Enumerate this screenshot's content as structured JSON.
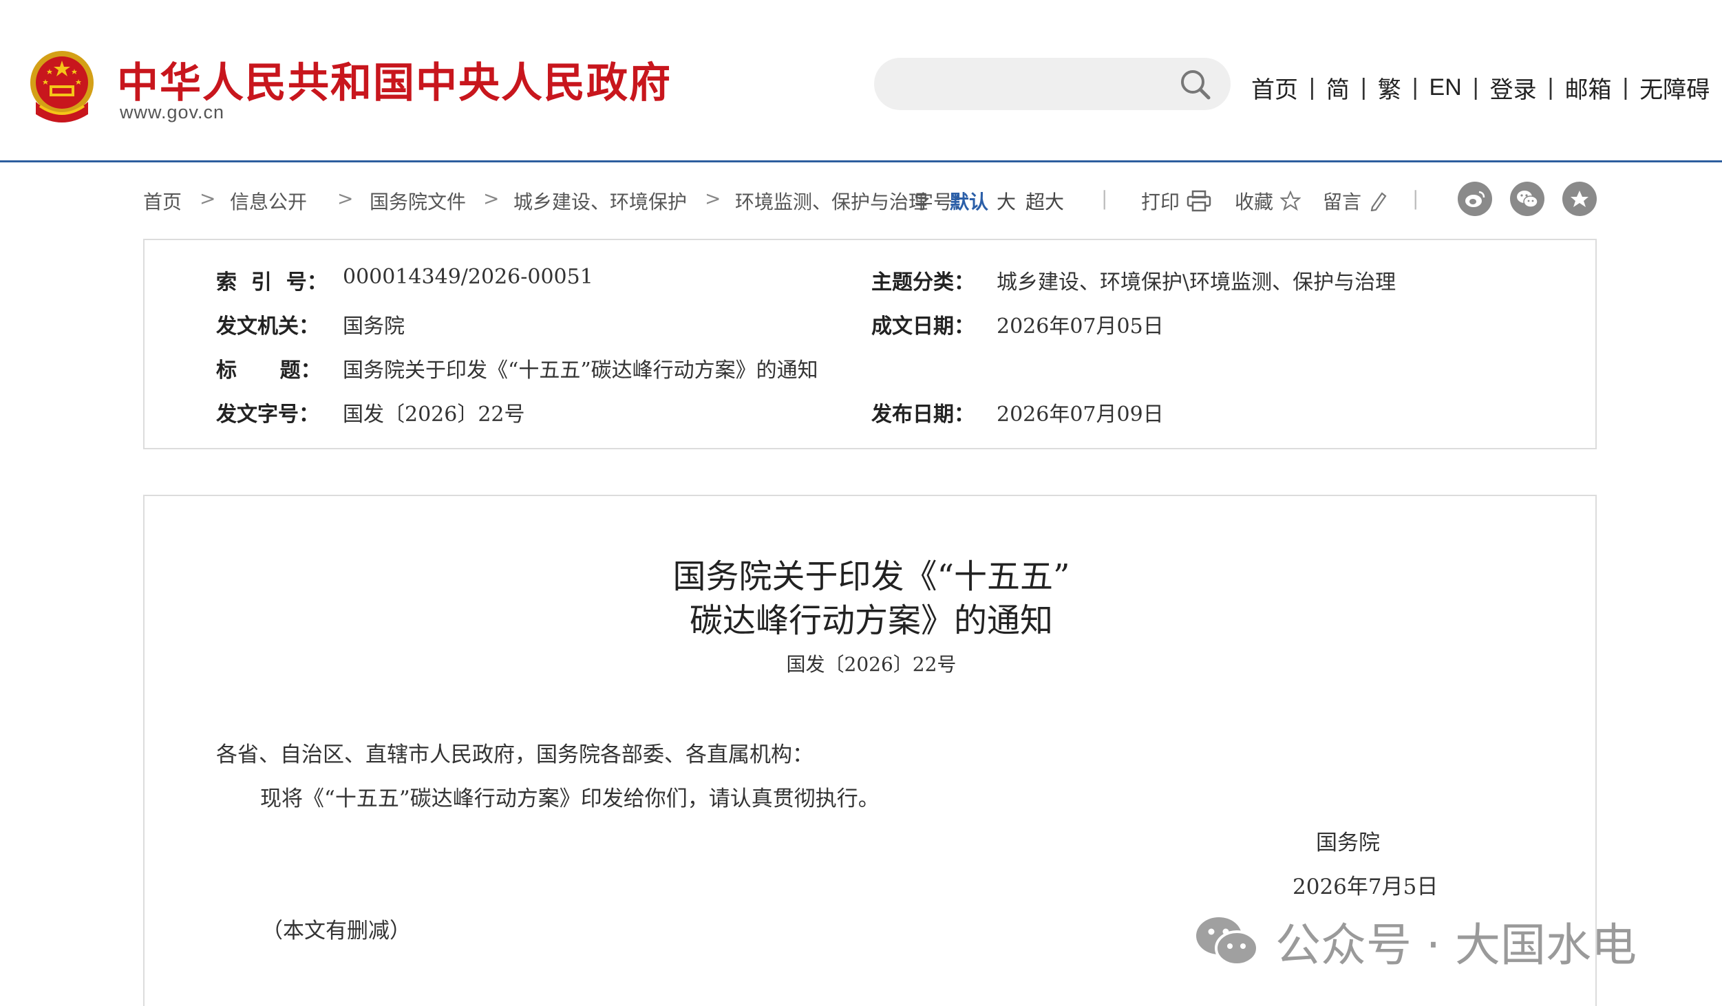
{
  "header": {
    "site_title": "中华人民共和国中央人民政府",
    "site_url": "www.gov.cn",
    "search": {
      "placeholder": "",
      "value": ""
    },
    "nav": [
      "首页",
      "简",
      "繁",
      "EN",
      "登录",
      "邮箱",
      "无障碍"
    ],
    "nav_separator": "|"
  },
  "breadcrumb": {
    "items": [
      "首页",
      "信息公开",
      "国务院文件",
      "城乡建设、环境保护",
      "环境监测、保护与治理"
    ],
    "separator": ">"
  },
  "font_size": {
    "label": "字号：",
    "options": [
      "默认",
      "大",
      "超大"
    ],
    "selected": "默认"
  },
  "tools": {
    "print": "打印",
    "favorite": "收藏",
    "comment": "留言",
    "divider": "|"
  },
  "share_icons": [
    "weibo-icon",
    "wechat-icon",
    "qzone-icon"
  ],
  "meta": {
    "index_no": {
      "label": "索  引  号：",
      "value": "000014349/2026-00051"
    },
    "category": {
      "label": "主题分类：",
      "value": "城乡建设、环境保护\\环境监测、保护与治理"
    },
    "issuer": {
      "label": "发文机关：",
      "value": "国务院"
    },
    "written_date": {
      "label": "成文日期：",
      "value": "2026年07月05日"
    },
    "title": {
      "label": "标      题：",
      "value": "国务院关于印发《“十五五”碳达峰行动方案》的通知"
    },
    "doc_no": {
      "label": "发文字号：",
      "value": "国发〔2026〕22号"
    },
    "publish_date": {
      "label": "发布日期：",
      "value": "2026年07月09日"
    }
  },
  "document": {
    "title_line1": "国务院关于印发《“十五五”",
    "title_line2": "碳达峰行动方案》的通知",
    "number": "国发〔2026〕22号",
    "salutation": "各省、自治区、直辖市人民政府，国务院各部委、各直属机构：",
    "body": "现将《“十五五”碳达峰行动方案》印发给你们，请认真贯彻执行。",
    "signatory": "国务院",
    "date": "2026年7月5日",
    "note": "（本文有删减）"
  },
  "watermark": {
    "text": "公众号 · 大国水电",
    "icon": "wechat-icon"
  },
  "colors": {
    "brand_red": "#c8161d",
    "accent_blue": "#2b5fa8",
    "header_rule": "#2d5e9e",
    "border": "#dcdcdc"
  }
}
